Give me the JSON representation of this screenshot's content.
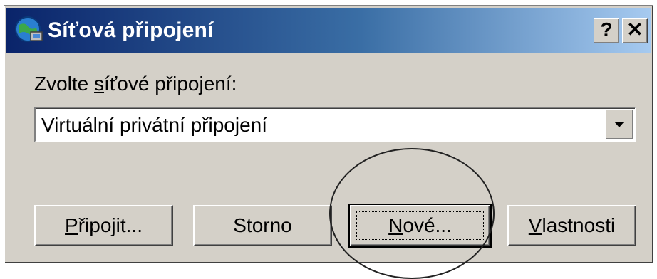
{
  "window": {
    "title": "Síťová připojení",
    "help_button": "?",
    "close_button": "✕"
  },
  "form": {
    "label_prefix": "Zvolte ",
    "label_accel": "s",
    "label_suffix": "íťové připojení:",
    "combo_value": "Virtuální privátní připojení"
  },
  "buttons": {
    "connect_accel": "P",
    "connect_rest": "řipojit...",
    "cancel": "Storno",
    "new_accel": "N",
    "new_rest": "ové...",
    "properties_accel": "V",
    "properties_rest": "lastnosti"
  },
  "icons": {
    "title_icon": "network-connections-icon",
    "combo_arrow": "dropdown-arrow-icon"
  },
  "colors": {
    "titlebar_start": "#0a246a",
    "titlebar_end": "#a6caf0",
    "face": "#d4d0c8"
  }
}
